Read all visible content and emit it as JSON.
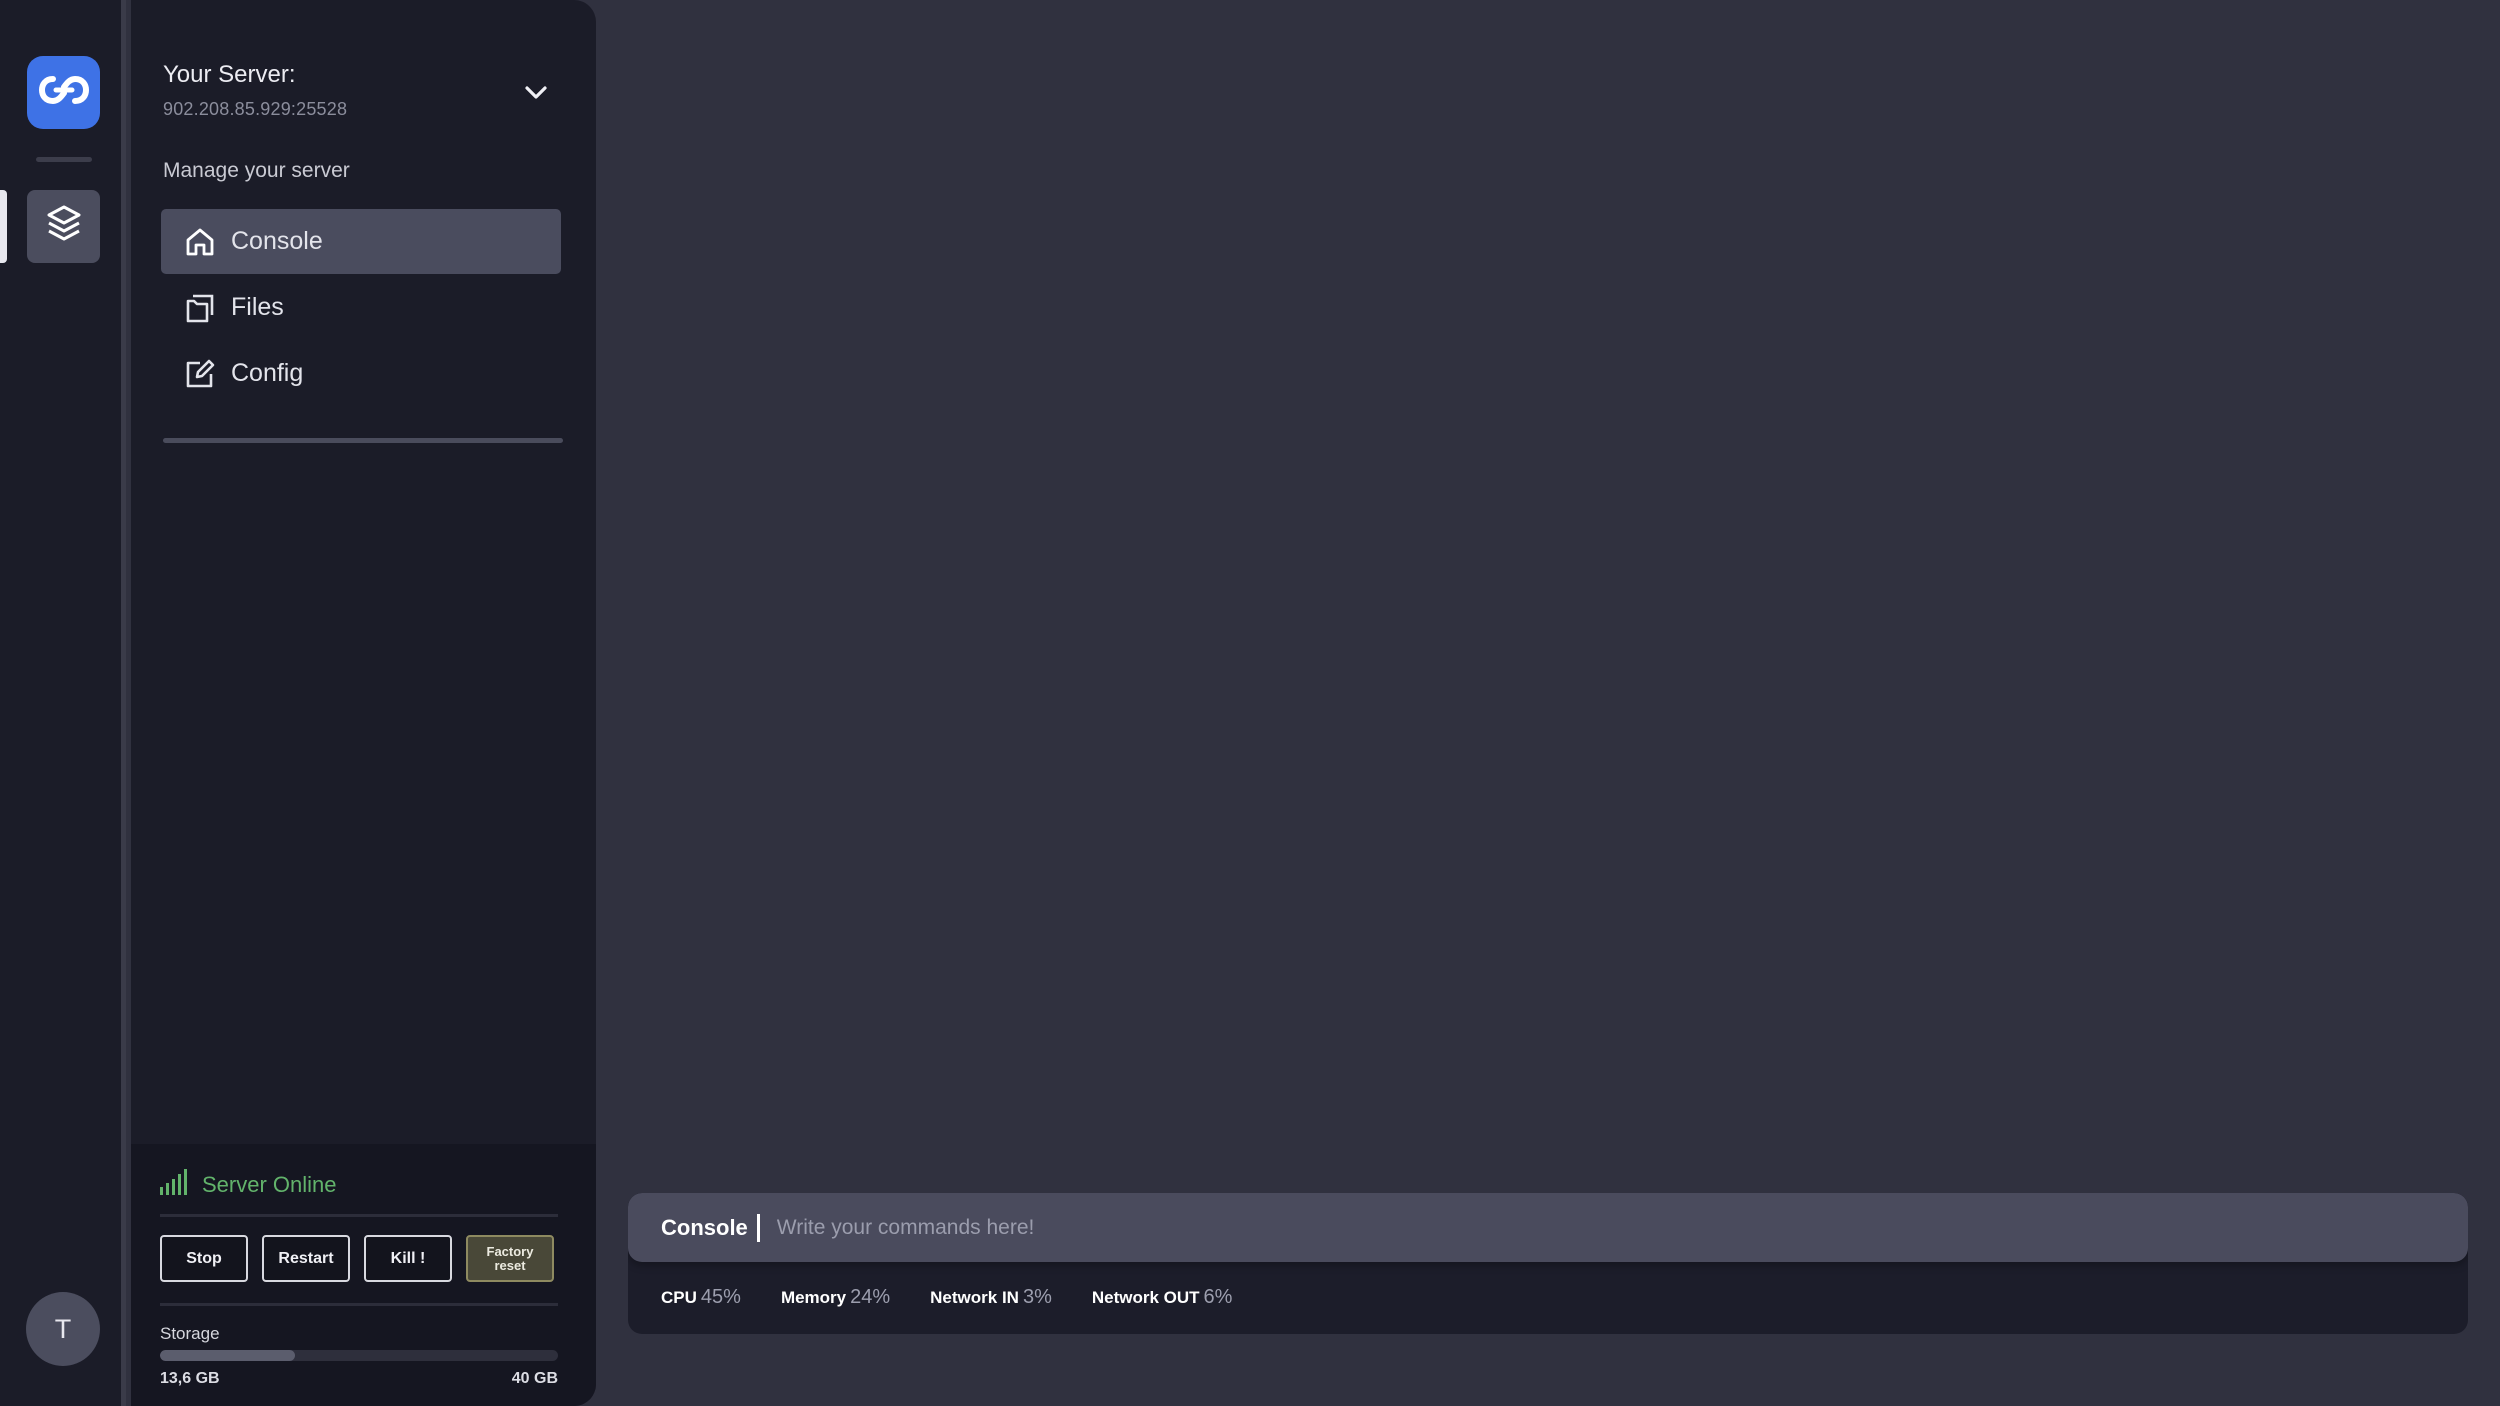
{
  "sidebar_rail": {
    "avatar_initial": "T",
    "brand_color": "#3e72e6",
    "logo_icon": "infinity-link-icon",
    "nav_icon": "layers-icon"
  },
  "server": {
    "title": "Your Server:",
    "address": "902.208.85.929:25528",
    "dropdown_icon": "chevron-down-icon"
  },
  "manage": {
    "label": "Manage your server",
    "items": [
      {
        "label": "Console",
        "icon": "home-icon",
        "active": true
      },
      {
        "label": "Files",
        "icon": "files-icon",
        "active": false
      },
      {
        "label": "Config",
        "icon": "edit-icon",
        "active": false
      }
    ]
  },
  "status": {
    "text": "Server Online",
    "color": "#62b36b",
    "icon": "signal-bars-icon"
  },
  "controls": {
    "stop": "Stop",
    "restart": "Restart",
    "kill": "Kill !",
    "factory_reset_line1": "Factory",
    "factory_reset_line2": "reset"
  },
  "storage": {
    "label": "Storage",
    "used": "13,6 GB",
    "total": "40 GB",
    "used_fraction": 0.34
  },
  "console": {
    "label": "Console",
    "placeholder": "Write your commands here!"
  },
  "metrics": [
    {
      "label": "CPU",
      "value": "45%"
    },
    {
      "label": "Memory",
      "value": "24%"
    },
    {
      "label": "Network IN",
      "value": "3%"
    },
    {
      "label": "Network OUT",
      "value": "6%"
    }
  ]
}
